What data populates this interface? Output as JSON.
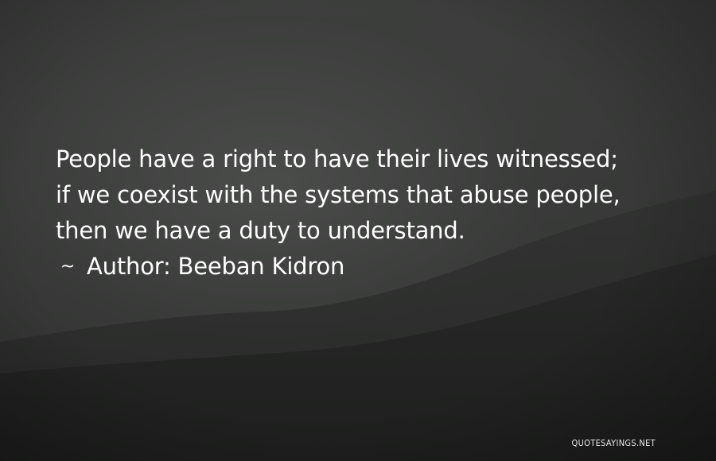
{
  "quote": {
    "lines": [
      "People have a right to have their lives witnessed;",
      "if we coexist with the systems that abuse people,",
      "then we have a duty to understand."
    ],
    "author_prefix": "~",
    "author_label": "Author: Beeban Kidron"
  },
  "watermark": {
    "text": "QUOTESAYINGS.NET"
  },
  "colors": {
    "background": "#2c2d2c",
    "text": "#ffffff"
  }
}
